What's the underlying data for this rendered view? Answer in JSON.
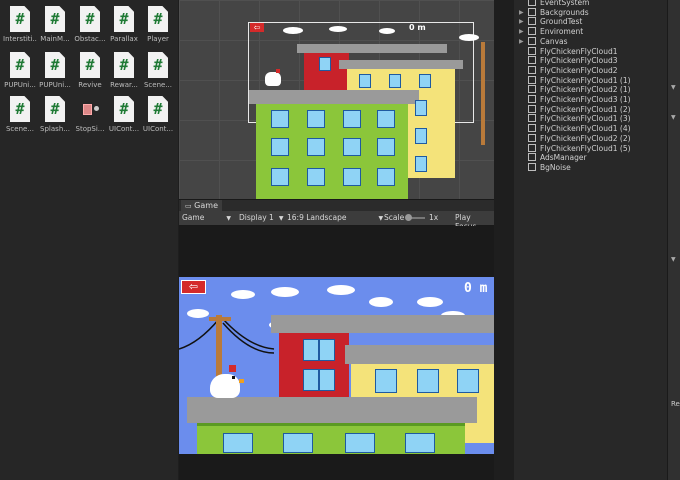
{
  "project": {
    "assets": [
      {
        "label": "Interstiti...",
        "icon": "script-icon"
      },
      {
        "label": "MainM...",
        "icon": "script-icon"
      },
      {
        "label": "Obstac...",
        "icon": "script-icon"
      },
      {
        "label": "Parallax",
        "icon": "script-icon"
      },
      {
        "label": "Player",
        "icon": "script-icon"
      },
      {
        "label": "PUPUni...",
        "icon": "script-icon"
      },
      {
        "label": "PUPUni...",
        "icon": "script-icon"
      },
      {
        "label": "Revive",
        "icon": "script-icon"
      },
      {
        "label": "Rewar...",
        "icon": "script-icon"
      },
      {
        "label": "Scene...",
        "icon": "script-icon"
      },
      {
        "label": "Scene...",
        "icon": "script-icon"
      },
      {
        "label": "Splash...",
        "icon": "script-icon"
      },
      {
        "label": "StopSi...",
        "icon": "prefab-icon"
      },
      {
        "label": "UICont...",
        "icon": "script-icon"
      },
      {
        "label": "UICont...",
        "icon": "script-icon"
      }
    ],
    "script_glyph": "#"
  },
  "scene": {
    "score": "0 m"
  },
  "game": {
    "tab_label": "Game",
    "mode": "Game",
    "display": "Display 1",
    "aspect": "16:9 Landscape",
    "scale_label": "Scale",
    "scale_value": "1x",
    "play_focus": "Play Focus",
    "score": "0 m"
  },
  "hierarchy": {
    "items": [
      {
        "label": "EventSystem",
        "expandable": false
      },
      {
        "label": "Backgrounds",
        "expandable": true
      },
      {
        "label": "GroundTest",
        "expandable": true
      },
      {
        "label": "Enviroment",
        "expandable": true
      },
      {
        "label": "Canvas",
        "expandable": true
      },
      {
        "label": "FlyChickenFlyCloud1",
        "expandable": false
      },
      {
        "label": "FlyChickenFlyCloud3",
        "expandable": false
      },
      {
        "label": "FlyChickenFlyCloud2",
        "expandable": false
      },
      {
        "label": "FlyChickenFlyCloud1 (1)",
        "expandable": false
      },
      {
        "label": "FlyChickenFlyCloud2 (1)",
        "expandable": false
      },
      {
        "label": "FlyChickenFlyCloud3 (1)",
        "expandable": false
      },
      {
        "label": "FlyChickenFlyCloud1 (2)",
        "expandable": false
      },
      {
        "label": "FlyChickenFlyCloud1 (3)",
        "expandable": false
      },
      {
        "label": "FlyChickenFlyCloud1 (4)",
        "expandable": false
      },
      {
        "label": "FlyChickenFlyCloud2 (2)",
        "expandable": false
      },
      {
        "label": "FlyChickenFlyCloud1 (5)",
        "expandable": false
      },
      {
        "label": "AdsManager",
        "expandable": false
      },
      {
        "label": "BgNoise",
        "expandable": false
      }
    ]
  },
  "inspector": {
    "partial_label": "Re"
  },
  "colors": {
    "game_bg": "#6b8ded",
    "building_green": "#8bc63a",
    "building_red": "#c8222a",
    "building_yellow": "#f4e37a",
    "roof_gray": "#9a9a9a",
    "back_button": "#d42a2a"
  }
}
